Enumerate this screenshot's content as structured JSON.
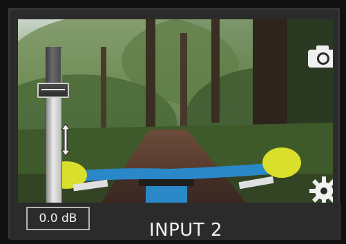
{
  "tile": {
    "input_name": "INPUT 2",
    "volume_db": "0.0 dB",
    "volume_level": 0.78
  },
  "icons": {
    "snapshot": "camera-icon",
    "settings": "gear-icon",
    "resize": "vertical-resize-icon"
  },
  "colors": {
    "background": "#2b2b2b",
    "text": "#f5f5f5",
    "fader_border": "#cfcfcf"
  }
}
